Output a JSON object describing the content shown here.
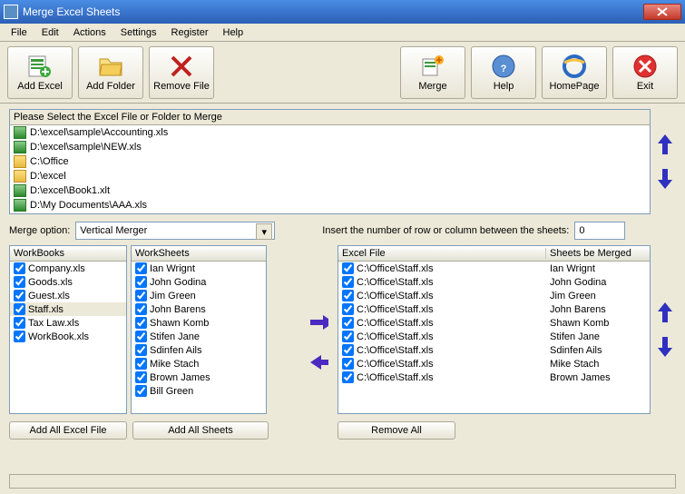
{
  "window": {
    "title": "Merge Excel Sheets"
  },
  "menu": {
    "file": "File",
    "edit": "Edit",
    "actions": "Actions",
    "settings": "Settings",
    "register": "Register",
    "help": "Help"
  },
  "toolbar": {
    "addExcel": "Add Excel",
    "addFolder": "Add Folder",
    "removeFile": "Remove File",
    "merge": "Merge",
    "help": "Help",
    "homepage": "HomePage",
    "exit": "Exit"
  },
  "filePanel": {
    "header": "Please Select the Excel File or Folder to Merge",
    "items": [
      {
        "type": "excel",
        "path": "D:\\excel\\sample\\Accounting.xls"
      },
      {
        "type": "excel",
        "path": "D:\\excel\\sample\\NEW.xls"
      },
      {
        "type": "folder",
        "path": "C:\\Office"
      },
      {
        "type": "folder",
        "path": "D:\\excel"
      },
      {
        "type": "excel",
        "path": "D:\\excel\\Book1.xlt"
      },
      {
        "type": "excel",
        "path": "D:\\My Documents\\AAA.xls"
      }
    ]
  },
  "mergeOption": {
    "label": "Merge option:",
    "value": "Vertical Merger"
  },
  "insertRow": {
    "label": "Insert the number of row or column between the sheets:",
    "value": "0"
  },
  "workbooks": {
    "header": "WorkBooks",
    "items": [
      "Company.xls",
      "Goods.xls",
      "Guest.xls",
      "Staff.xls",
      "Tax Law.xls",
      "WorkBook.xls"
    ],
    "selectedIndex": 3
  },
  "worksheets": {
    "header": "WorkSheets",
    "items": [
      "Ian Wrignt",
      "John Godina",
      "Jim Green",
      "John Barens",
      "Shawn Komb",
      "Stifen Jane",
      "Sdinfen Ails",
      "Mike Stach",
      "Brown James",
      "Bill Green"
    ]
  },
  "merged": {
    "header1": "Excel File",
    "header2": "Sheets be Merged",
    "rows": [
      {
        "file": "C:\\Office\\Staff.xls",
        "sheet": "Ian Wrignt"
      },
      {
        "file": "C:\\Office\\Staff.xls",
        "sheet": "John Godina"
      },
      {
        "file": "C:\\Office\\Staff.xls",
        "sheet": "Jim Green"
      },
      {
        "file": "C:\\Office\\Staff.xls",
        "sheet": "John Barens"
      },
      {
        "file": "C:\\Office\\Staff.xls",
        "sheet": "Shawn Komb"
      },
      {
        "file": "C:\\Office\\Staff.xls",
        "sheet": "Stifen Jane"
      },
      {
        "file": "C:\\Office\\Staff.xls",
        "sheet": "Sdinfen Ails"
      },
      {
        "file": "C:\\Office\\Staff.xls",
        "sheet": "Mike Stach"
      },
      {
        "file": "C:\\Office\\Staff.xls",
        "sheet": "Brown James"
      }
    ]
  },
  "buttons": {
    "addAllExcel": "Add All Excel File",
    "addAllSheets": "Add All Sheets",
    "removeAll": "Remove All"
  }
}
